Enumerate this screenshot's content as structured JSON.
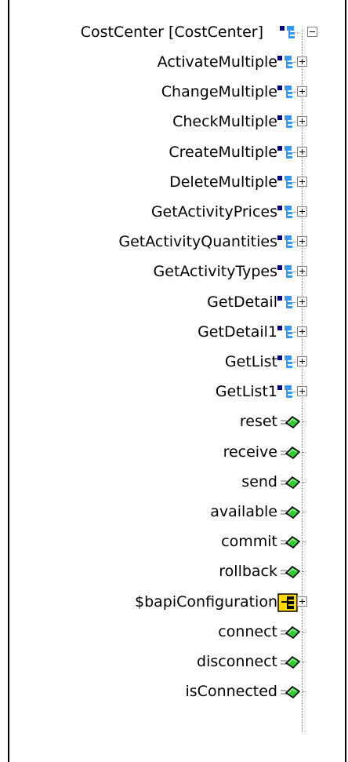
{
  "tree": {
    "root": {
      "label": "CostCenter [CostCenter]",
      "icon": "class-icon",
      "expanded": true
    },
    "children": [
      {
        "label": "ActivateMultiple",
        "icon": "method-icon",
        "expandable": true
      },
      {
        "label": "ChangeMultiple",
        "icon": "method-icon",
        "expandable": true
      },
      {
        "label": "CheckMultiple",
        "icon": "method-icon",
        "expandable": true
      },
      {
        "label": "CreateMultiple",
        "icon": "method-icon",
        "expandable": true
      },
      {
        "label": "DeleteMultiple",
        "icon": "method-icon",
        "expandable": true
      },
      {
        "label": "GetActivityPrices",
        "icon": "method-icon",
        "expandable": true
      },
      {
        "label": "GetActivityQuantities",
        "icon": "method-icon",
        "expandable": true
      },
      {
        "label": "GetActivityTypes",
        "icon": "method-icon",
        "expandable": true
      },
      {
        "label": "GetDetail",
        "icon": "method-icon",
        "expandable": true
      },
      {
        "label": "GetDetail1",
        "icon": "method-icon",
        "expandable": true
      },
      {
        "label": "GetList",
        "icon": "method-icon",
        "expandable": true
      },
      {
        "label": "GetList1",
        "icon": "method-icon",
        "expandable": true
      },
      {
        "label": "reset",
        "icon": "function-icon",
        "expandable": false
      },
      {
        "label": "receive",
        "icon": "function-icon",
        "expandable": false
      },
      {
        "label": "send",
        "icon": "function-icon",
        "expandable": false
      },
      {
        "label": "available",
        "icon": "function-icon",
        "expandable": false
      },
      {
        "label": "commit",
        "icon": "function-icon",
        "expandable": false
      },
      {
        "label": "rollback",
        "icon": "function-icon",
        "expandable": false
      },
      {
        "label": "$bapiConfiguration",
        "icon": "property-icon",
        "expandable": true
      },
      {
        "label": "connect",
        "icon": "function-icon",
        "expandable": false
      },
      {
        "label": "disconnect",
        "icon": "function-icon",
        "expandable": false
      },
      {
        "label": "isConnected",
        "icon": "function-icon",
        "expandable": false
      }
    ]
  },
  "colors": {
    "method_dark": "#000080",
    "method_light": "#3399ff",
    "function_green": "#33cc33",
    "property_yellow": "#ffd800",
    "tree_line": "#808080"
  }
}
